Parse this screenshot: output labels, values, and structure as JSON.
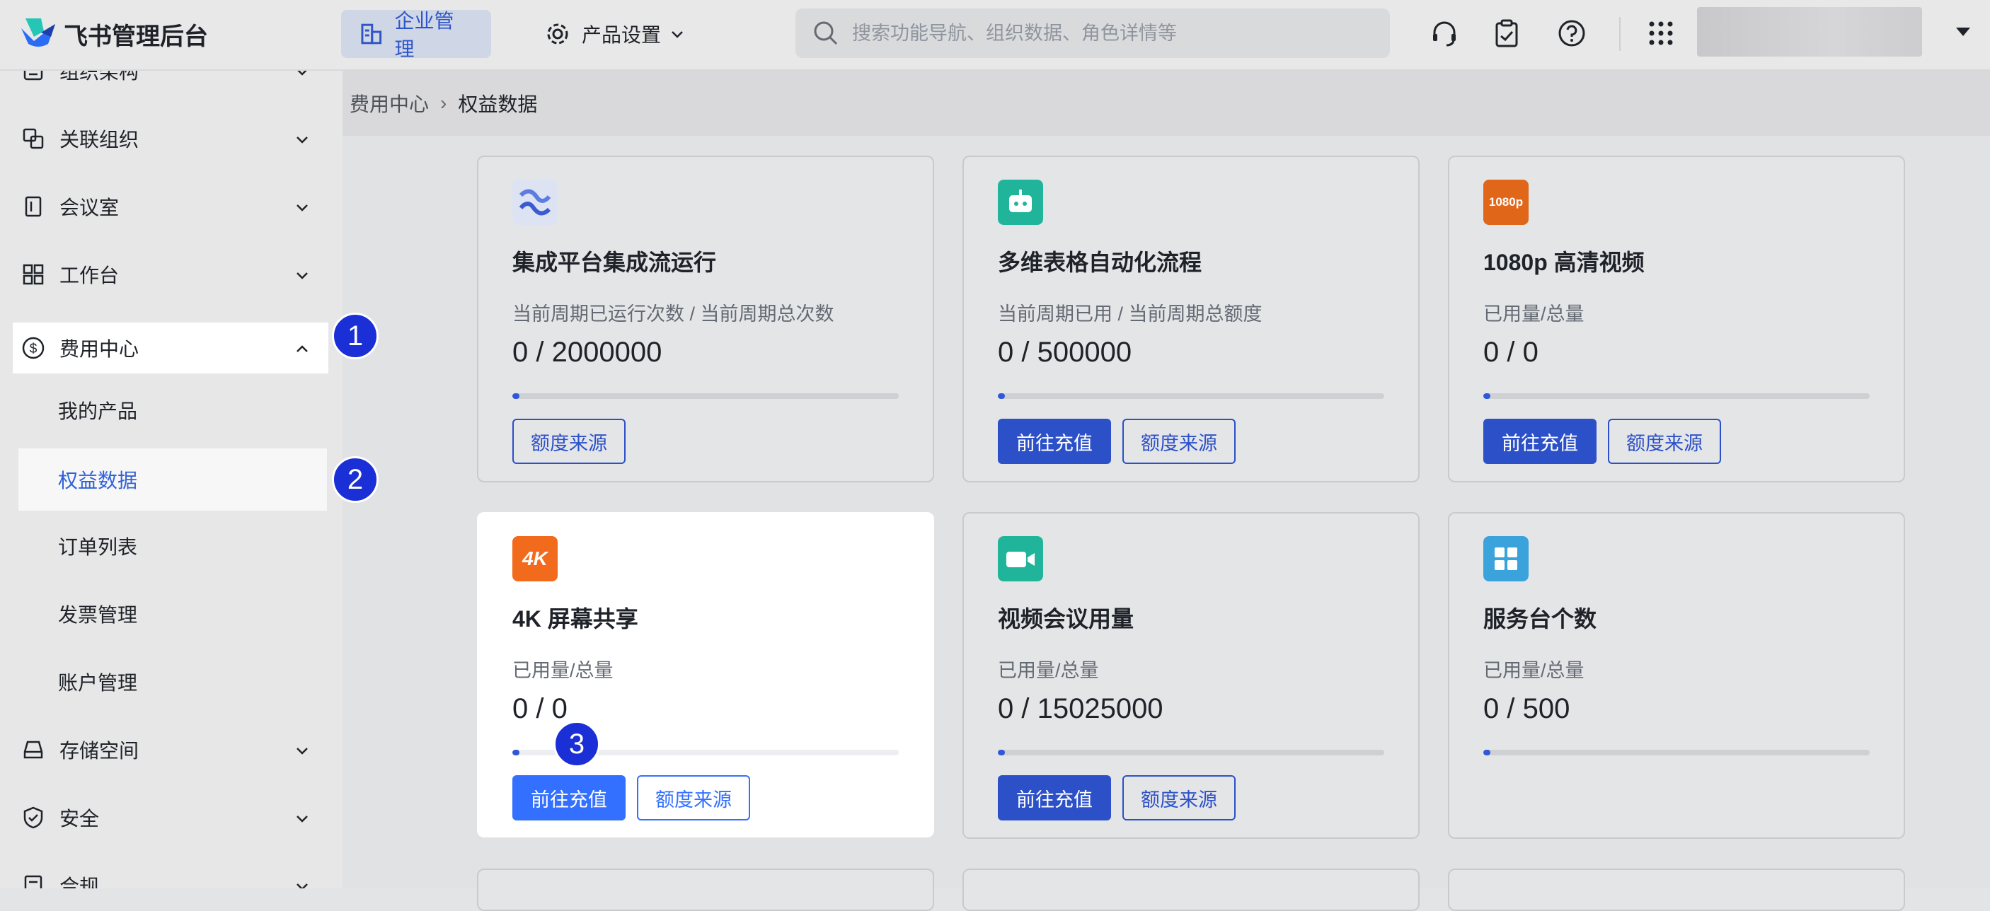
{
  "topbar": {
    "app_name": "飞书管理后台",
    "tabs": [
      {
        "label": "企业管理",
        "icon": "building-icon",
        "active": true
      },
      {
        "label": "产品设置",
        "icon": "gear-icon",
        "active": false
      }
    ],
    "search_placeholder": "搜索功能导航、组织数据、角色详情等",
    "icons": [
      "headset-icon",
      "clipboard-icon",
      "help-icon",
      "apps-grid-icon"
    ]
  },
  "sidebar": {
    "items": [
      {
        "label": "组织架构",
        "icon": "org-icon"
      },
      {
        "label": "关联组织",
        "icon": "link-org-icon"
      },
      {
        "label": "会议室",
        "icon": "door-icon"
      },
      {
        "label": "工作台",
        "icon": "grid-icon"
      },
      {
        "label": "费用中心",
        "icon": "dollar-icon",
        "expanded": true
      },
      {
        "label": "存储空间",
        "icon": "storage-icon"
      },
      {
        "label": "安全",
        "icon": "shield-icon"
      },
      {
        "label": "合规",
        "icon": "document-icon"
      }
    ],
    "sub_items": [
      {
        "label": "我的产品"
      },
      {
        "label": "权益数据",
        "active": true
      },
      {
        "label": "订单列表"
      },
      {
        "label": "发票管理"
      },
      {
        "label": "账户管理"
      }
    ]
  },
  "breadcrumb": {
    "parent": "费用中心",
    "current": "权益数据"
  },
  "cards": [
    {
      "title": "集成平台集成流运行",
      "metric": "当前周期已运行次数 / 当前周期总次数",
      "value": "0 / 2000000",
      "usage": 0,
      "recharge": null,
      "source": "额度来源",
      "icon": "integration-icon"
    },
    {
      "title": "多维表格自动化流程",
      "metric": "当前周期已用 / 当前周期总额度",
      "value": "0 / 500000",
      "usage": 0,
      "recharge": "前往充值",
      "source": "额度来源",
      "icon": "robot-icon"
    },
    {
      "title": "1080p 高清视频",
      "metric": "已用量/总量",
      "value": "0 / 0",
      "usage": 0,
      "recharge": "前往充值",
      "source": "额度来源",
      "icon": "video-1080p-icon",
      "badge_text": "1080p"
    },
    {
      "title": "4K 屏幕共享",
      "metric": "已用量/总量",
      "value": "0 / 0",
      "usage": 0,
      "recharge": "前往充值",
      "source": "额度来源",
      "icon": "screen-4k-icon",
      "badge_text": "4K"
    },
    {
      "title": "视频会议用量",
      "metric": "已用量/总量",
      "value": "0 / 15025000",
      "usage": 0,
      "recharge": "前往充值",
      "source": "额度来源",
      "icon": "video-camera-icon"
    },
    {
      "title": "服务台个数",
      "metric": "已用量/总量",
      "value": "0 / 500",
      "usage": 0,
      "recharge": null,
      "source": null,
      "icon": "service-desk-icon"
    }
  ],
  "steps": [
    "1",
    "2",
    "3"
  ],
  "colors": {
    "accent": "#3370ff",
    "step_marker": "#1a2fd6",
    "orange_badge": "#f26a1b",
    "teal_badge": "#20b59a",
    "blue_badge": "#3aa3dc"
  }
}
